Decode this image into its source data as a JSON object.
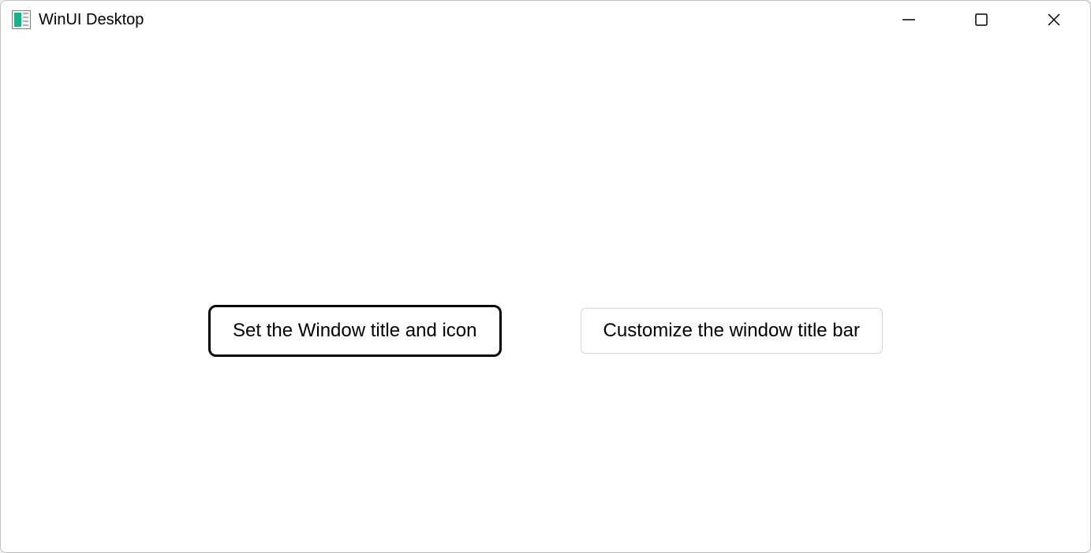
{
  "window": {
    "title": "WinUI Desktop"
  },
  "buttons": {
    "set_title": "Set the Window title and icon",
    "customize": "Customize the window title bar"
  }
}
